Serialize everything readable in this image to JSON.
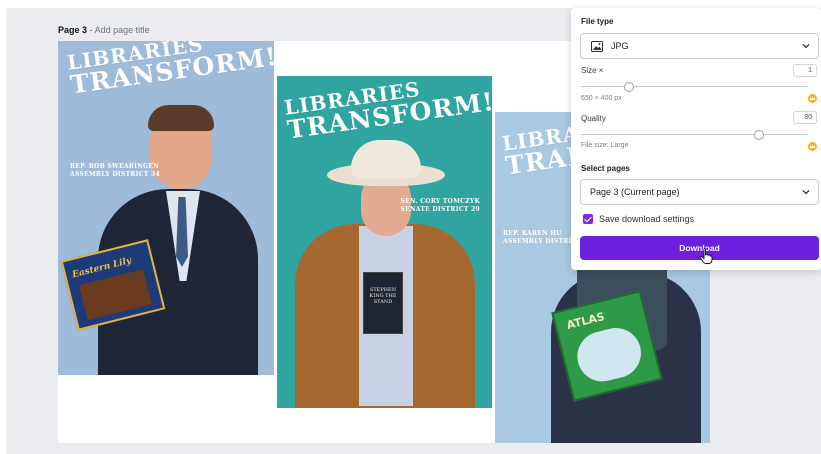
{
  "page": {
    "page_number_label": "Page 3",
    "separator": "-",
    "add_title_placeholder": "Add page title"
  },
  "posters": [
    {
      "headline_line1": "LIBRARIES",
      "headline_line2": "TRANSFORM!",
      "caption_line1": "REP. ROB SWEARINGEN",
      "caption_line2": "ASSEMBLY DISTRICT 34",
      "book_title": "Eastern Lily",
      "background_color": "#9ebcd9"
    },
    {
      "headline_line1": "LIBRARIES",
      "headline_line2": "TRANSFORM!",
      "caption_line1": "SEN. CORY TOMCZYK",
      "caption_line2": "SENATE DISTRICT 29",
      "book_title": "STEPHEN KING THE STAND",
      "background_color": "#2fa4a1"
    },
    {
      "headline_line1": "LIBRAR",
      "headline_line2": "TRAN",
      "caption_line1": "REP. KAREN HU",
      "caption_line2": "ASSEMBLY DISTRICT",
      "book_title": "ATLAS",
      "background_color": "#a9c8e2"
    }
  ],
  "download_panel": {
    "file_type_label": "File type",
    "file_type_value": "JPG",
    "size_label": "Size ×",
    "size_multiplier": "1",
    "size_dimensions": "650 × 400 px",
    "quality_label": "Quality",
    "quality_value": "80",
    "file_size_text": "File size: Large",
    "select_pages_label": "Select pages",
    "select_pages_value": "Page 3 (Current page)",
    "save_settings_label": "Save download settings",
    "save_settings_checked": true,
    "download_button_label": "Download",
    "accent_color": "#6b1fdf",
    "pro_badge_color": "#f5b31b",
    "size_slider_fraction": 0.2,
    "quality_slider_fraction": 0.8
  }
}
